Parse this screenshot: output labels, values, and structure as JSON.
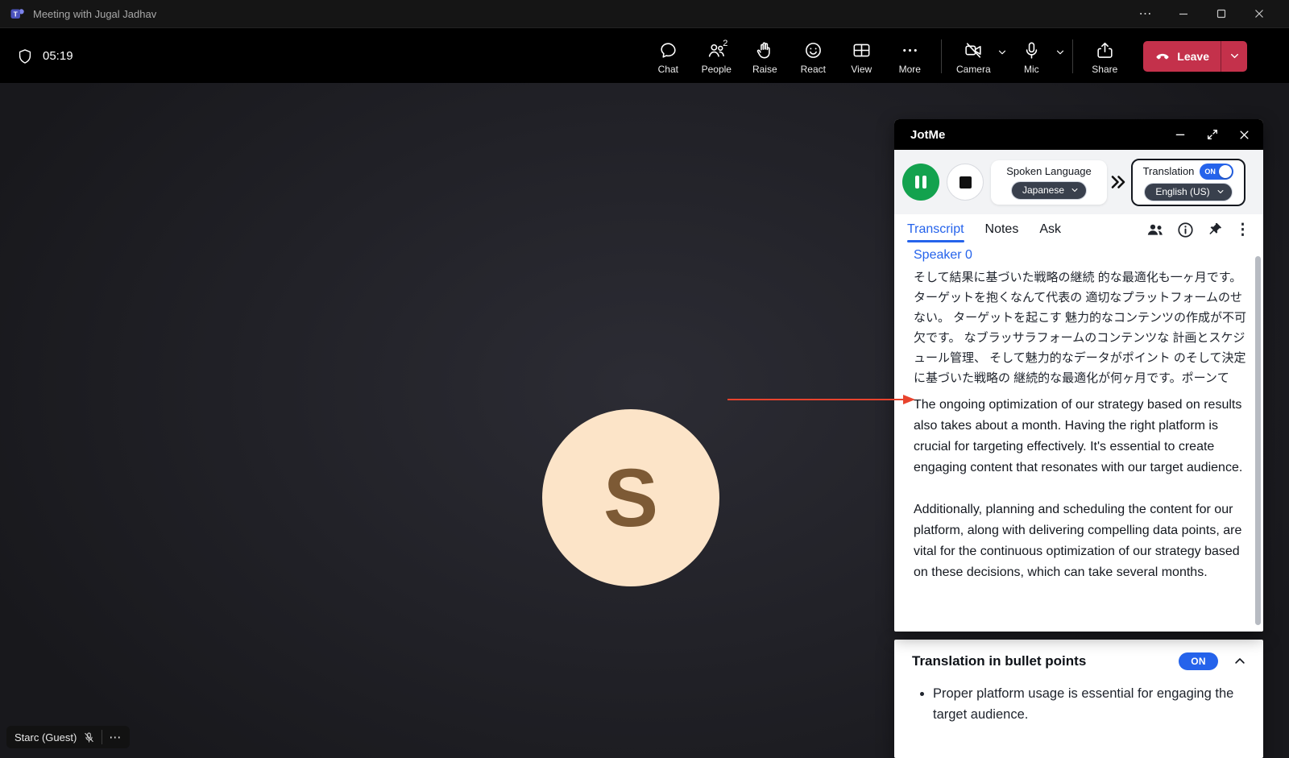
{
  "titlebar": {
    "app_title": "Meeting with Jugal Jadhav"
  },
  "toolbar": {
    "timer": "05:19",
    "buttons": [
      {
        "label": "Chat"
      },
      {
        "label": "People",
        "badge": "2"
      },
      {
        "label": "Raise"
      },
      {
        "label": "React"
      },
      {
        "label": "View"
      },
      {
        "label": "More"
      }
    ],
    "camera_label": "Camera",
    "mic_label": "Mic",
    "share_label": "Share",
    "leave_label": "Leave"
  },
  "stage": {
    "avatar_letter": "S",
    "participant_label": "Starc (Guest)"
  },
  "jotme": {
    "title": "JotMe",
    "controls": {
      "spoken_language_label": "Spoken Language",
      "spoken_language_value": "Japanese",
      "translation_label": "Translation",
      "translation_toggle": "ON",
      "target_language_value": "English (US)"
    },
    "tabs": [
      {
        "label": "Transcript"
      },
      {
        "label": "Notes"
      },
      {
        "label": "Ask"
      }
    ],
    "speaker_label": "Speaker 0",
    "transcript_ja": "そして結果に基づいた戦略の継続 的な最適化も一ヶ月です。 ターゲットを抱くなんて代表の 適切なプラットフォームのせない。 ターゲットを起こす 魅力的なコンテンツの作成が不可欠です。 なブラッサラフォームのコンテンツな 計画とスケジュール管理、 そして魅力的なデータがポイント のそして決定に基づいた戦略の 継続的な最適化が何ヶ月です。ポーンて",
    "transcript_en_p1": "The ongoing optimization of our strategy based on results also takes about a month. Having the right platform is crucial for targeting effectively. It's essential to create engaging content that resonates with our target audience.",
    "transcript_en_p2": "Additionally, planning and scheduling the content for our platform, along with delivering compelling data points, are vital for the continuous optimization of our strategy based on these decisions, which can take several months.",
    "bullet_card": {
      "title": "Translation in bullet points",
      "toggle": "ON",
      "bullets": [
        {
          "text": "Proper platform usage is essential for engaging the target audience."
        }
      ]
    }
  },
  "icons": {
    "titlebar_more": "⋯",
    "kebab": "⋮",
    "participant_more": "⋯"
  },
  "colors": {
    "accent_blue": "#2563eb",
    "leave_red": "#c4314b",
    "record_green": "#13a24e",
    "arrow_red": "#e8432d",
    "avatar_bg": "#fce4c8",
    "avatar_letter": "#7d5a35"
  }
}
